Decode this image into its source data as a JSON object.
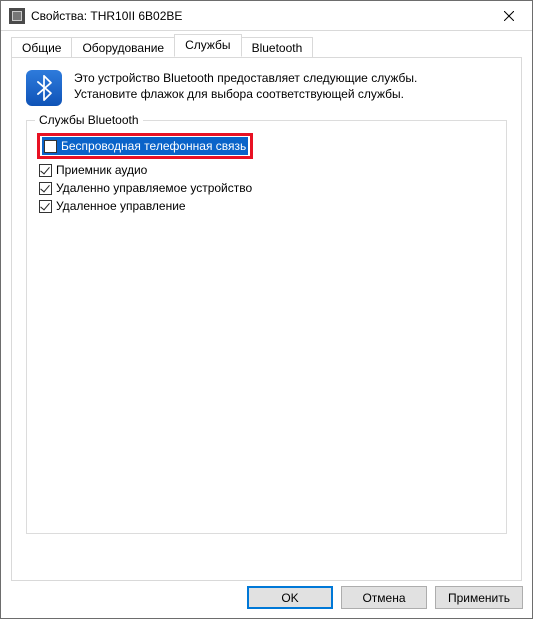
{
  "window": {
    "title": "Свойства: THR10II 6B02BE"
  },
  "tabs": {
    "general": "Общие",
    "hardware": "Оборудование",
    "services": "Службы",
    "bluetooth": "Bluetooth",
    "active": "services"
  },
  "info": {
    "line1": "Это устройство Bluetooth предоставляет следующие службы.",
    "line2": "Установите флажок для выбора соответствующей службы."
  },
  "group": {
    "legend": "Службы Bluetooth",
    "services": [
      {
        "label": "Беспроводная телефонная связь",
        "checked": false,
        "selected": true,
        "highlighted": true
      },
      {
        "label": "Приемник аудио",
        "checked": true,
        "selected": false,
        "highlighted": false
      },
      {
        "label": "Удаленно управляемое устройство",
        "checked": true,
        "selected": false,
        "highlighted": false
      },
      {
        "label": "Удаленное управление",
        "checked": true,
        "selected": false,
        "highlighted": false
      }
    ]
  },
  "buttons": {
    "ok": "OK",
    "cancel": "Отмена",
    "apply": "Применить"
  }
}
